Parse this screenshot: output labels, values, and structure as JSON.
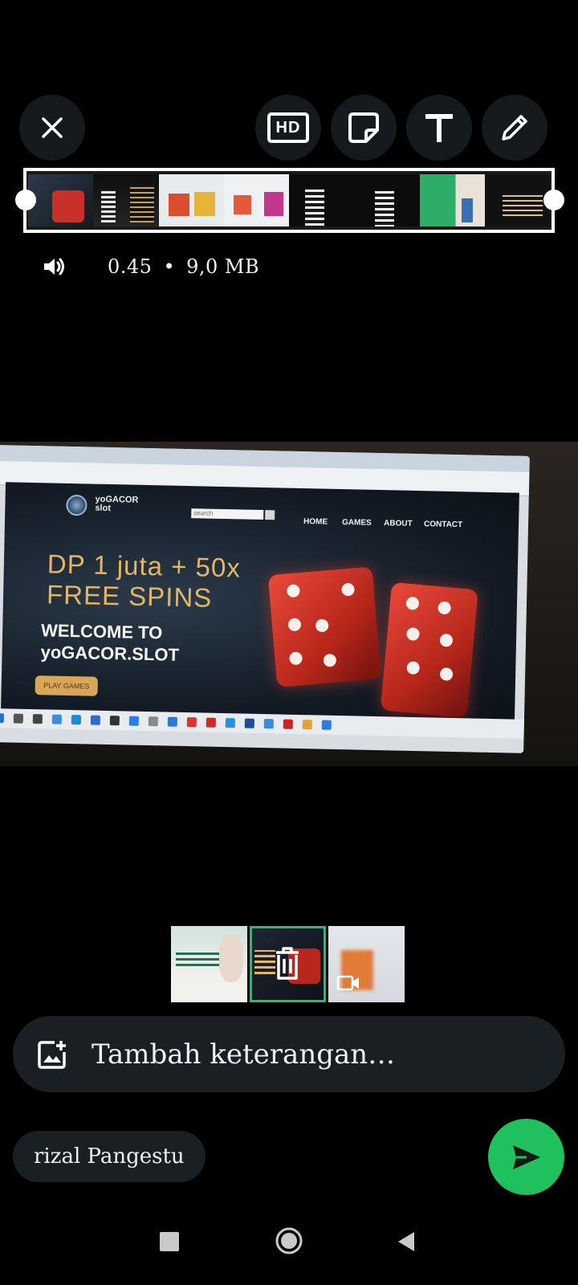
{
  "toolbar": {
    "close": "close-icon",
    "hd_label": "HD",
    "sticker": "sticker-icon",
    "text": "text-icon",
    "draw": "pencil-icon"
  },
  "video_info": {
    "duration": "0.45",
    "separator": "•",
    "size": "9,0 MB"
  },
  "photo_content": {
    "site_logo_line1": "yoGACOR",
    "site_logo_line2": "slot",
    "search_placeholder": "search",
    "nav": [
      "HOME",
      "GAMES",
      "ABOUT",
      "CONTACT"
    ],
    "promo_line1": "DP 1 juta + 50x",
    "promo_line2": "FREE SPINS",
    "welcome_line1": "WELCOME TO",
    "welcome_line2": "yoGACOR.SLOT",
    "play_button": "PLAY GAMES"
  },
  "caption": {
    "placeholder": "Tambah keterangan…"
  },
  "recipient": {
    "name": "rizal Pangestu"
  },
  "colors": {
    "accent": "#20c15c",
    "surface": "#1a1f24"
  }
}
